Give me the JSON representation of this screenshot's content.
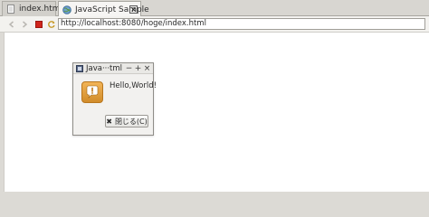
{
  "tabs": [
    {
      "label": "index.html",
      "active": false
    },
    {
      "label": "JavaScript Sample",
      "active": true
    }
  ],
  "toolbar": {
    "icons": [
      "back-arrow-icon",
      "forward-arrow-icon",
      "stop-icon",
      "reload-icon"
    ],
    "url": "http://localhost:8080/hoge/index.html"
  },
  "dialog": {
    "title": "Java···tml",
    "controls": {
      "minimize": "−",
      "maximize": "+",
      "close": "×"
    },
    "message": "Hello,World!",
    "button_label": "閉じる(C)",
    "button_icon": "✖",
    "icon": "info-exclamation-icon"
  },
  "colors": {
    "chrome_bg": "#dcdad5",
    "content_bg": "#ffffff",
    "stop_red": "#d0251c",
    "dialog_icon_orange": "#e7a140"
  }
}
